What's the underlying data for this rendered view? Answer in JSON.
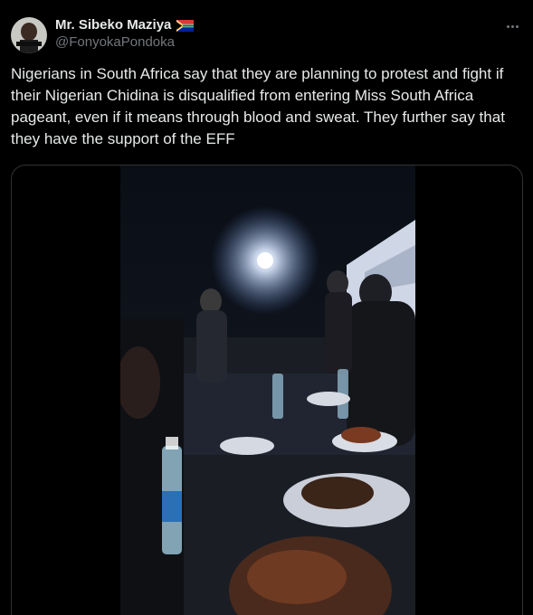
{
  "author": {
    "display_name": "Mr. Sibeko Maziya",
    "handle": "@FonyokaPondoka",
    "flag_icon": "south-africa-flag-icon"
  },
  "tweet": {
    "text": "Nigerians in South Africa say that they are planning to protest and fight if their Nigerian Chidina is disqualified from entering Miss South Africa pageant, even if it means through blood and sweat. They further say that they have the support of the EFF"
  },
  "media": {
    "type": "video"
  },
  "colors": {
    "background": "#000000",
    "primary_text": "#e7e9ea",
    "secondary_text": "#71767b",
    "border": "#2f3336"
  }
}
